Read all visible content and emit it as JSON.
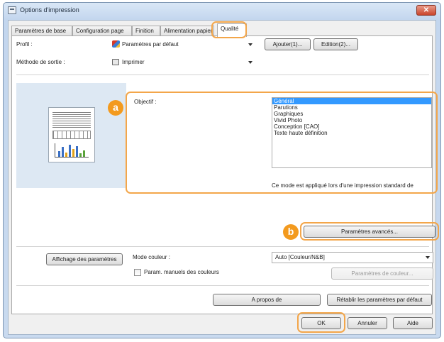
{
  "window": {
    "title": "Options d'impression",
    "close_symbol": "✕"
  },
  "tabs": [
    {
      "label": "Paramètres de base"
    },
    {
      "label": "Configuration page"
    },
    {
      "label": "Finition"
    },
    {
      "label": "Alimentation papier"
    },
    {
      "label": "Qualité"
    }
  ],
  "profile": {
    "label": "Profil :",
    "value": "Paramètres par défaut",
    "add_button": "Ajouter(1)...",
    "edit_button": "Edition(2)..."
  },
  "output_method": {
    "label": "Méthode de sortie :",
    "value": "Imprimer"
  },
  "objective": {
    "label": "Objectif :",
    "items": [
      "Général",
      "Parutions",
      "Graphiques",
      "Vivid Photo",
      "Conception [CAO]",
      "Texte haute définition"
    ],
    "selected_index": 0,
    "description": "Ce mode est appliqué lors d'une impression standard de documents."
  },
  "advanced_button": "Paramètres avancés...",
  "view_settings_button": "Affichage des paramètres",
  "color_mode": {
    "label": "Mode couleur :",
    "value": "Auto [Couleur/N&B]"
  },
  "manual_color": {
    "checkbox_label": "Param. manuels des couleurs",
    "checked": false,
    "button": "Paramètres de couleur..."
  },
  "about_button": "A propos de",
  "restore_defaults_button": "Rétablir les paramètres par défaut",
  "footer": {
    "ok": "OK",
    "cancel": "Annuler",
    "help": "Aide"
  },
  "callouts": {
    "a": "a",
    "b": "b"
  },
  "colors": {
    "callout_orange": "#f3a64a",
    "badge_orange": "#f39a1e",
    "selection_blue": "#3399ff"
  }
}
